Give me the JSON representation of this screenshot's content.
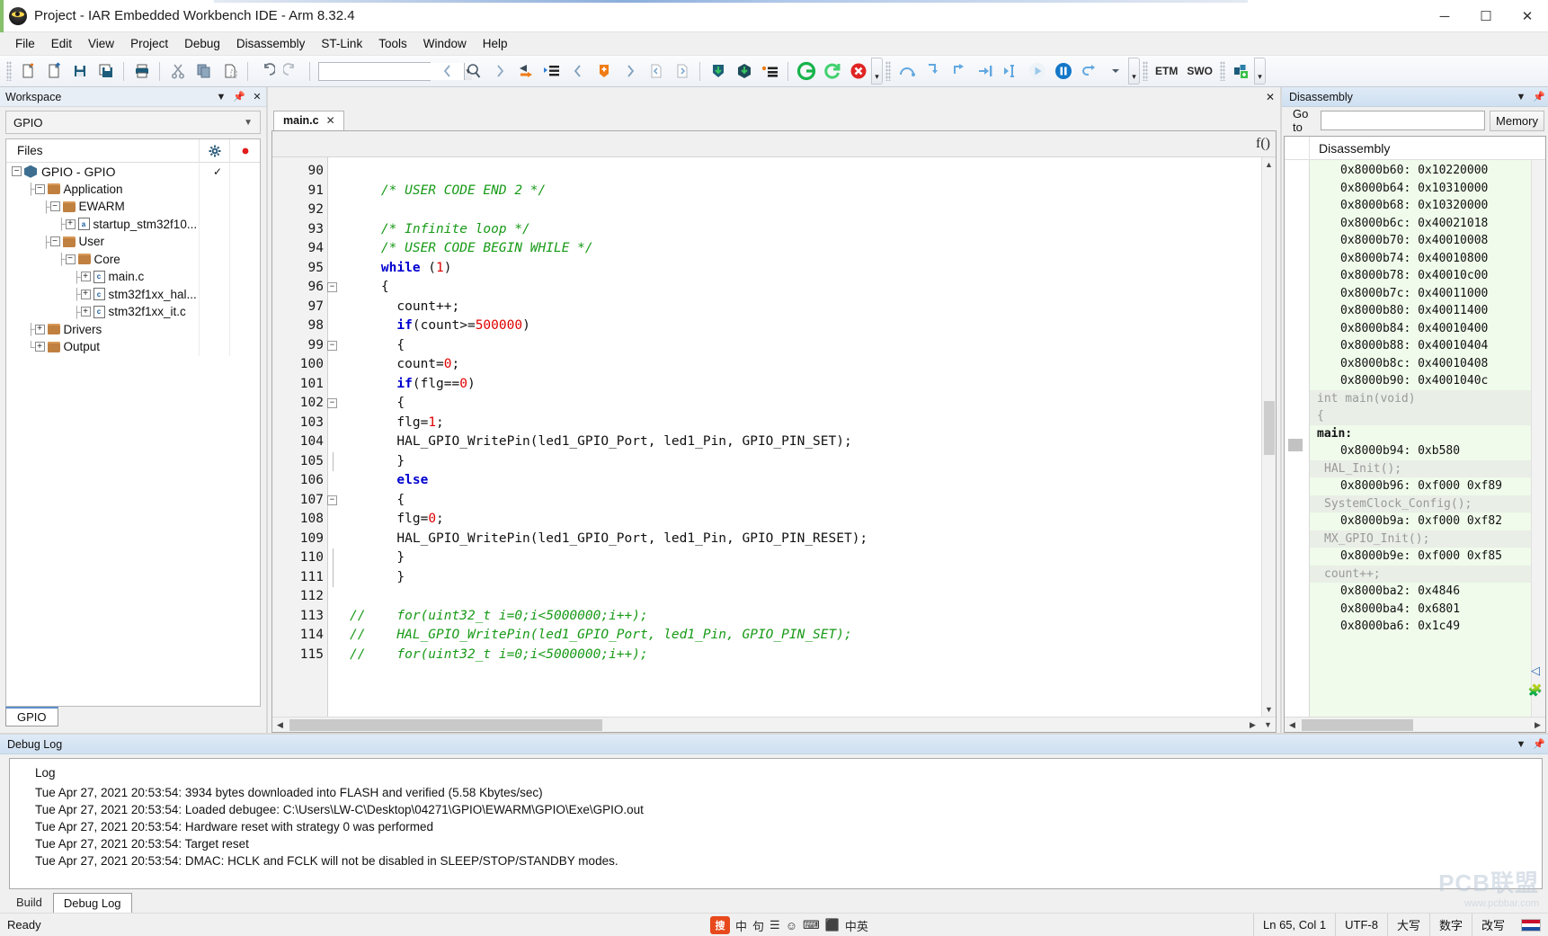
{
  "window": {
    "title": "Project - IAR Embedded Workbench IDE - Arm 8.32.4",
    "app_icon": "iar-bug-icon",
    "minimize": "─",
    "maximize": "☐",
    "close": "✕"
  },
  "menu": {
    "items": [
      "File",
      "Edit",
      "View",
      "Project",
      "Debug",
      "Disassembly",
      "ST-Link",
      "Tools",
      "Window",
      "Help"
    ]
  },
  "toolbar": {
    "groups": [
      {
        "icons": [
          "new-file-icon",
          "open-file-icon",
          "save-icon",
          "save-all-icon"
        ]
      },
      {
        "icons": [
          "print-icon"
        ]
      },
      {
        "icons": [
          "cut-icon",
          "copy-icon",
          "paste-icon"
        ]
      },
      {
        "icons": [
          "undo-icon",
          "redo-icon"
        ]
      }
    ],
    "search_combo_value": "",
    "nav_icons": [
      "navigate-back-icon",
      "find-icon",
      "navigate-forward-icon",
      "goto-definition-icon",
      "bookmark-list-icon",
      "prev-bookmark-icon",
      "toggle-bookmark-icon",
      "next-bookmark-icon",
      "prev-file-icon",
      "next-file-icon"
    ],
    "build_icons": [
      "compile-icon",
      "make-icon",
      "build-options-icon"
    ],
    "debug_icons": [
      "download-debug-icon",
      "restart-debug-icon",
      "stop-debug-icon"
    ],
    "step_icons": [
      "step-over-icon",
      "step-into-icon",
      "step-out-icon",
      "next-statement-icon",
      "run-to-cursor-icon",
      "go-icon",
      "break-icon",
      "reset-icon",
      "reset-dropdown-icon"
    ],
    "etm_label": "ETM",
    "swo_label": "SWO",
    "extra_icons": [
      "live-watch-icon"
    ],
    "overflow_glyph": "▾"
  },
  "workspace": {
    "caption": "Workspace",
    "caption_icons": [
      "chevron-down-icon",
      "pin-icon"
    ],
    "config_value": "GPIO",
    "header": {
      "files": "Files",
      "gear_icon": "gear-icon",
      "dot_icon": "red-dot-icon"
    },
    "tree": [
      {
        "depth": 0,
        "expander": "−",
        "icon": "project-icon",
        "label": "GPIO - GPIO",
        "check": "✓"
      },
      {
        "depth": 1,
        "expander": "−",
        "icon": "folder-icon",
        "label": "Application",
        "check": ""
      },
      {
        "depth": 2,
        "expander": "−",
        "icon": "folder-icon",
        "label": "EWARM",
        "check": ""
      },
      {
        "depth": 3,
        "expander": "+",
        "icon": "asm-file-icon",
        "label": "startup_stm32f10...",
        "check": ""
      },
      {
        "depth": 2,
        "expander": "−",
        "icon": "folder-icon",
        "label": "User",
        "check": ""
      },
      {
        "depth": 3,
        "expander": "−",
        "icon": "folder-icon",
        "label": "Core",
        "check": ""
      },
      {
        "depth": 4,
        "expander": "+",
        "icon": "c-file-icon",
        "label": "main.c",
        "check": ""
      },
      {
        "depth": 4,
        "expander": "+",
        "icon": "c-file-icon",
        "label": "stm32f1xx_hal...",
        "check": ""
      },
      {
        "depth": 4,
        "expander": "+",
        "icon": "c-file-icon",
        "label": "stm32f1xx_it.c",
        "check": ""
      },
      {
        "depth": 1,
        "expander": "+",
        "icon": "folder-icon",
        "label": "Drivers",
        "check": ""
      },
      {
        "depth": 1,
        "expander": "+",
        "icon": "folder-icon",
        "label": "Output",
        "check": ""
      }
    ],
    "footer_tab": "GPIO"
  },
  "editor": {
    "tab": {
      "label": "main.c",
      "close": "✕"
    },
    "panel_close": "✕",
    "func_icon": "f()",
    "first_line_number": 90,
    "lines": [
      {
        "n": 90,
        "fold": "",
        "tokens": []
      },
      {
        "n": 91,
        "fold": "",
        "tokens": [
          {
            "t": "    /* USER CODE END 2 */",
            "c": "cm"
          }
        ]
      },
      {
        "n": 92,
        "fold": "",
        "tokens": []
      },
      {
        "n": 93,
        "fold": "",
        "tokens": [
          {
            "t": "    /* Infinite loop */",
            "c": "cm"
          }
        ]
      },
      {
        "n": 94,
        "fold": "",
        "tokens": [
          {
            "t": "    /* USER CODE BEGIN WHILE */",
            "c": "cm"
          }
        ]
      },
      {
        "n": 95,
        "fold": "",
        "tokens": [
          {
            "t": "    ",
            "c": ""
          },
          {
            "t": "while",
            "c": "kw"
          },
          {
            "t": " (",
            "c": ""
          },
          {
            "t": "1",
            "c": "num"
          },
          {
            "t": ")",
            "c": ""
          }
        ]
      },
      {
        "n": 96,
        "fold": "−",
        "tokens": [
          {
            "t": "    {",
            "c": ""
          }
        ]
      },
      {
        "n": 97,
        "fold": "",
        "tokens": [
          {
            "t": "      count++;",
            "c": ""
          }
        ]
      },
      {
        "n": 98,
        "fold": "",
        "tokens": [
          {
            "t": "      ",
            "c": ""
          },
          {
            "t": "if",
            "c": "kw"
          },
          {
            "t": "(count>=",
            "c": ""
          },
          {
            "t": "500000",
            "c": "num"
          },
          {
            "t": ")",
            "c": ""
          }
        ]
      },
      {
        "n": 99,
        "fold": "−",
        "tokens": [
          {
            "t": "      {",
            "c": ""
          }
        ]
      },
      {
        "n": 100,
        "fold": "",
        "tokens": [
          {
            "t": "      count=",
            "c": ""
          },
          {
            "t": "0",
            "c": "num"
          },
          {
            "t": ";",
            "c": ""
          }
        ]
      },
      {
        "n": 101,
        "fold": "",
        "tokens": [
          {
            "t": "      ",
            "c": ""
          },
          {
            "t": "if",
            "c": "kw"
          },
          {
            "t": "(flg==",
            "c": ""
          },
          {
            "t": "0",
            "c": "num"
          },
          {
            "t": ")",
            "c": ""
          }
        ]
      },
      {
        "n": 102,
        "fold": "−",
        "tokens": [
          {
            "t": "      {",
            "c": ""
          }
        ]
      },
      {
        "n": 103,
        "fold": "",
        "tokens": [
          {
            "t": "      flg=",
            "c": ""
          },
          {
            "t": "1",
            "c": "num"
          },
          {
            "t": ";",
            "c": ""
          }
        ]
      },
      {
        "n": 104,
        "fold": "",
        "tokens": [
          {
            "t": "      HAL_GPIO_WritePin(led1_GPIO_Port, led1_Pin, GPIO_PIN_SET);",
            "c": ""
          }
        ]
      },
      {
        "n": 105,
        "fold": "|",
        "tokens": [
          {
            "t": "      }",
            "c": ""
          }
        ]
      },
      {
        "n": 106,
        "fold": "",
        "tokens": [
          {
            "t": "      ",
            "c": ""
          },
          {
            "t": "else",
            "c": "kw"
          }
        ]
      },
      {
        "n": 107,
        "fold": "−",
        "tokens": [
          {
            "t": "      {",
            "c": ""
          }
        ]
      },
      {
        "n": 108,
        "fold": "",
        "tokens": [
          {
            "t": "      flg=",
            "c": ""
          },
          {
            "t": "0",
            "c": "num"
          },
          {
            "t": ";",
            "c": ""
          }
        ]
      },
      {
        "n": 109,
        "fold": "",
        "tokens": [
          {
            "t": "      HAL_GPIO_WritePin(led1_GPIO_Port, led1_Pin, GPIO_PIN_RESET);",
            "c": ""
          }
        ]
      },
      {
        "n": 110,
        "fold": "|",
        "tokens": [
          {
            "t": "      }",
            "c": ""
          }
        ]
      },
      {
        "n": 111,
        "fold": "|",
        "tokens": [
          {
            "t": "      }",
            "c": ""
          }
        ]
      },
      {
        "n": 112,
        "fold": "",
        "tokens": []
      },
      {
        "n": 113,
        "fold": "",
        "tokens": [
          {
            "t": "//    for(uint32_t i=0;i<5000000;i++);",
            "c": "cm"
          }
        ]
      },
      {
        "n": 114,
        "fold": "",
        "tokens": [
          {
            "t": "//    HAL_GPIO_WritePin(led1_GPIO_Port, led1_Pin, GPIO_PIN_SET);",
            "c": "cm"
          }
        ]
      },
      {
        "n": 115,
        "fold": "",
        "tokens": [
          {
            "t": "//    for(uint32_t i=0;i<5000000;i++);",
            "c": "cm"
          }
        ]
      }
    ]
  },
  "disassembly": {
    "caption": "Disassembly",
    "caption_icons": [
      "chevron-down-icon",
      "pin-icon"
    ],
    "goto_label": "Go to",
    "goto_value": "",
    "memory_button": "Memory",
    "column_header": "Disassembly",
    "rows": [
      {
        "kind": "addr",
        "text": "0x8000b60: 0x10220000"
      },
      {
        "kind": "addr",
        "text": "0x8000b64: 0x10310000"
      },
      {
        "kind": "addr",
        "text": "0x8000b68: 0x10320000"
      },
      {
        "kind": "addr",
        "text": "0x8000b6c: 0x40021018"
      },
      {
        "kind": "addr",
        "text": "0x8000b70: 0x40010008"
      },
      {
        "kind": "addr",
        "text": "0x8000b74: 0x40010800"
      },
      {
        "kind": "addr",
        "text": "0x8000b78: 0x40010c00"
      },
      {
        "kind": "addr",
        "text": "0x8000b7c: 0x40011000"
      },
      {
        "kind": "addr",
        "text": "0x8000b80: 0x40011400"
      },
      {
        "kind": "addr",
        "text": "0x8000b84: 0x40010400"
      },
      {
        "kind": "addr",
        "text": "0x8000b88: 0x40010404"
      },
      {
        "kind": "addr",
        "text": "0x8000b8c: 0x40010408"
      },
      {
        "kind": "addr",
        "text": "0x8000b90: 0x4001040c"
      },
      {
        "kind": "srcplain",
        "text": "int main(void)"
      },
      {
        "kind": "srcplain",
        "text": "{"
      },
      {
        "kind": "label",
        "text": "main:"
      },
      {
        "kind": "addr",
        "text": "0x8000b94: 0xb580"
      },
      {
        "kind": "src",
        "text": "HAL_Init();"
      },
      {
        "kind": "addr",
        "text": "0x8000b96: 0xf000 0xf89"
      },
      {
        "kind": "src",
        "text": "SystemClock_Config();"
      },
      {
        "kind": "addr",
        "text": "0x8000b9a: 0xf000 0xf82"
      },
      {
        "kind": "src",
        "text": "MX_GPIO_Init();"
      },
      {
        "kind": "addr",
        "text": "0x8000b9e: 0xf000 0xf85"
      },
      {
        "kind": "src",
        "text": "count++;"
      },
      {
        "kind": "addr",
        "text": "0x8000ba2: 0x4846"
      },
      {
        "kind": "addr",
        "text": "0x8000ba4: 0x6801"
      },
      {
        "kind": "addr",
        "text": "0x8000ba6: 0x1c49"
      }
    ]
  },
  "debug_log": {
    "caption": "Debug Log",
    "caption_icons": [
      "chevron-down-icon",
      "pin-icon"
    ],
    "column_header": "Log",
    "entries": [
      "Tue Apr 27, 2021 20:53:54: 3934 bytes downloaded into FLASH and verified (5.58 Kbytes/sec)",
      "Tue Apr 27, 2021 20:53:54: Loaded debugee: C:\\Users\\LW-C\\Desktop\\04271\\GPIO\\EWARM\\GPIO\\Exe\\GPIO.out",
      "Tue Apr 27, 2021 20:53:54: Hardware reset with strategy 0 was performed",
      "Tue Apr 27, 2021 20:53:54: Target reset",
      "Tue Apr 27, 2021 20:53:54: DMAC: HCLK and FCLK will not be disabled in SLEEP/STOP/STANDBY modes."
    ],
    "tabs": [
      {
        "label": "Build",
        "active": false
      },
      {
        "label": "Debug Log",
        "active": true
      }
    ]
  },
  "status_bar": {
    "ready": "Ready",
    "cursor": "Ln 65, Col 1",
    "encoding": "UTF-8",
    "ime": [
      "大写",
      "数字",
      "改写"
    ],
    "ime_tray": [
      "sogou-logo",
      "中",
      "句",
      "☰",
      "☺",
      "⌨",
      "⬛",
      "中英"
    ],
    "flag_icon": "cn-flag-icon"
  },
  "watermark": {
    "line1": "PCB联盟",
    "line2": "www.pcbbar.com"
  },
  "edge_icons": [
    "collapse-arrow-icon",
    "puzzle-icon"
  ],
  "colors": {
    "comment_green": "#179a17",
    "keyword_blue": "#0000d0",
    "number_red": "#e00000",
    "disasm_bg": "#f0fbeb",
    "caption_blue": "#cfe0f1"
  }
}
